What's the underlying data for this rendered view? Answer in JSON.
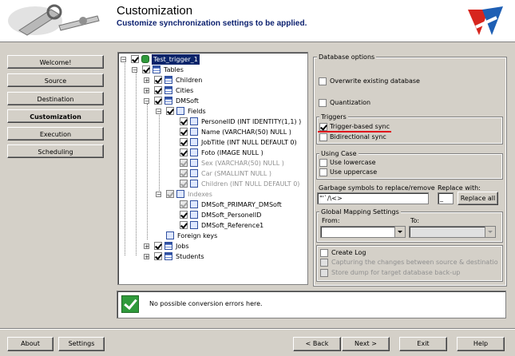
{
  "header": {
    "title": "Customization",
    "subtitle": "Customize synchronization settings to be applied."
  },
  "nav": {
    "items": [
      {
        "label": "Welcome!"
      },
      {
        "label": "Source"
      },
      {
        "label": "Destination"
      },
      {
        "label": "Customization",
        "active": true
      },
      {
        "label": "Execution"
      },
      {
        "label": "Scheduling"
      }
    ]
  },
  "tree": {
    "root": "Test_trigger_1",
    "tables": "Tables",
    "children": "Children",
    "cities": "Cities",
    "dmsoft": "DMSoft",
    "fields": "Fields",
    "field_items": [
      "PersonelID (INT IDENTITY(1,1) )",
      "Name (VARCHAR(50) NULL )",
      "JobTitle (INT NULL  DEFAULT 0)",
      "Foto (IMAGE NULL )",
      "Sex (VARCHAR(50) NULL )",
      "Car (SMALLINT NULL )",
      "Children (INT NULL  DEFAULT 0)"
    ],
    "indexes": "Indexes",
    "index_items": [
      "DMSoft_PRIMARY_DMSoft",
      "DMSoft_PersonelID",
      "DMSoft_Reference1"
    ],
    "foreign_keys": "Foreign keys",
    "jobs": "Jobs",
    "students": "Students"
  },
  "options": {
    "database_options": "Database options",
    "overwrite": "Overwrite existing database",
    "quantization": "Quantization",
    "triggers": "Triggers",
    "trigger_sync": "Trigger-based sync",
    "bidirectional": "Bidirectional sync",
    "using_case": "Using Case",
    "lowercase": "Use lowercase",
    "uppercase": "Use uppercase",
    "garbage_label": "Garbage symbols to replace/remove",
    "garbage_value": "\"'`/\\<>",
    "replace_with_label": "Replace with:",
    "replace_with_value": "_",
    "replace_all": "Replace all",
    "global_mapping": "Global Mapping Settings",
    "from_label": "From:",
    "to_label": "To:",
    "create_log": "Create Log",
    "capturing": "Capturing the changes between source & destinatio",
    "store_dump": "Store dump for target database back-up"
  },
  "status": {
    "message": "No possible conversion errors here."
  },
  "footer": {
    "about": "About",
    "settings": "Settings",
    "back": "< Back",
    "next": "Next >",
    "exit": "Exit",
    "help": "Help"
  }
}
